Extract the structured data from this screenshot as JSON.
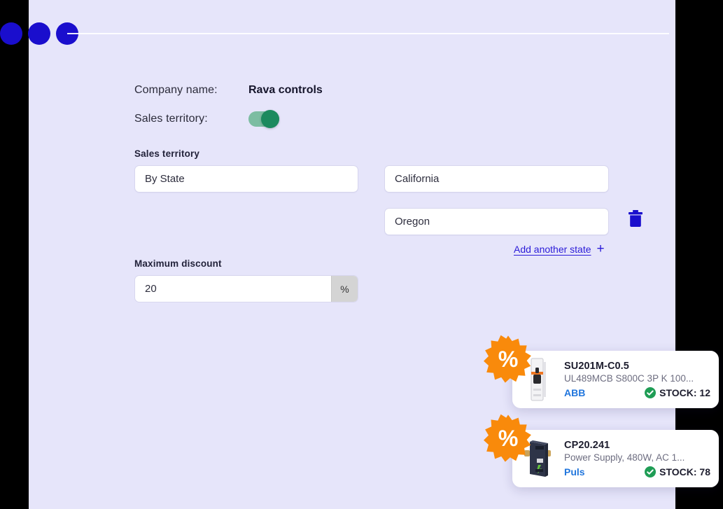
{
  "window": {
    "dot_color": "#1a0ecd",
    "panel_bg": "#e6e5fa",
    "backdrop": "#000000"
  },
  "form": {
    "company_name_label": "Company name:",
    "company_name_value": "Rava controls",
    "sales_territory_label": "Sales territory:",
    "sales_territory_toggle_on": true,
    "toggle_track_color": "#7cbda2",
    "toggle_knob_color": "#1c8a5e",
    "territory_section_label": "Sales territory",
    "territory_mode": "By State",
    "states": [
      "California",
      "Oregon"
    ],
    "add_state_label": "Add another state",
    "add_state_icon": "plus-icon",
    "delete_icon": "trash-icon",
    "link_color": "#2a1ad8",
    "discount_label": "Maximum discount",
    "discount_value": "20",
    "discount_unit": "%"
  },
  "products": [
    {
      "badge_icon": "percent-discount-badge",
      "badge_symbol": "%",
      "badge_color": "#f98a0b",
      "thumbnail": "circuit-breaker-image",
      "title": "SU201M-C0.5",
      "description": "UL489MCB S800C 3P K 100...",
      "brand": "ABB",
      "stock_label": "STOCK: 12",
      "stock_icon": "check-circle-icon",
      "stock_icon_color": "#1f9d55"
    },
    {
      "badge_icon": "percent-discount-badge",
      "badge_symbol": "%",
      "badge_color": "#f98a0b",
      "thumbnail": "power-supply-image",
      "title": "CP20.241",
      "description": "Power Supply, 480W, AC 1...",
      "brand": "Puls",
      "stock_label": "STOCK: 78",
      "stock_icon": "check-circle-icon",
      "stock_icon_color": "#1f9d55"
    }
  ]
}
